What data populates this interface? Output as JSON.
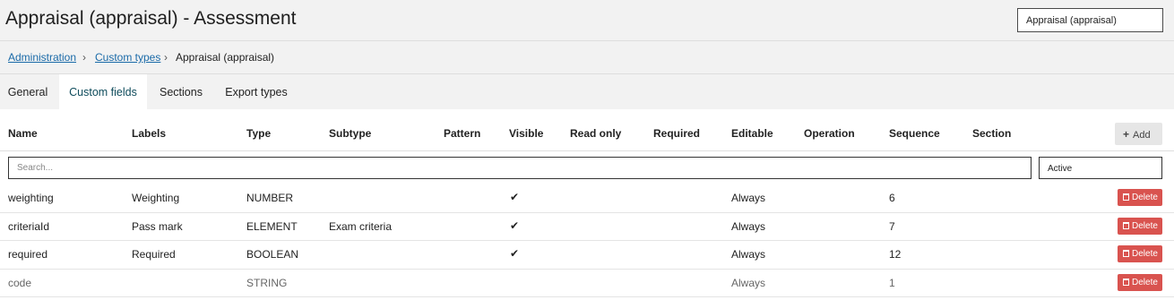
{
  "header": {
    "title": "Appraisal (appraisal) - Assessment",
    "type_select_value": "Appraisal (appraisal)"
  },
  "breadcrumb": {
    "items": [
      "Administration",
      "Custom types",
      "Appraisal (appraisal)"
    ],
    "separator": "›"
  },
  "tabs": [
    {
      "label": "General"
    },
    {
      "label": "Custom fields",
      "active": true
    },
    {
      "label": "Sections"
    },
    {
      "label": "Export types"
    }
  ],
  "table": {
    "columns": [
      "Name",
      "Labels",
      "Type",
      "Subtype",
      "Pattern",
      "Visible",
      "Read only",
      "Required",
      "Editable",
      "Operation",
      "Sequence",
      "Section"
    ],
    "add_label": "Add",
    "search_placeholder": "Search...",
    "status_filter": "Active",
    "check_icon": "check-icon",
    "delete_label": "Delete",
    "rows": [
      {
        "name": "weighting",
        "labels": "Weighting",
        "type": "NUMBER",
        "subtype": "",
        "visible": true,
        "editable": "Always",
        "sequence": "6"
      },
      {
        "name": "criteriaId",
        "labels": "Pass mark",
        "type": "ELEMENT",
        "subtype": "Exam criteria",
        "visible": true,
        "editable": "Always",
        "sequence": "7"
      },
      {
        "name": "required",
        "labels": "Required",
        "type": "BOOLEAN",
        "subtype": "",
        "visible": true,
        "editable": "Always",
        "sequence": "12"
      },
      {
        "name": "code",
        "labels": "",
        "type": "STRING",
        "subtype": "",
        "visible": false,
        "editable": "Always",
        "sequence": "1",
        "muted": true
      }
    ]
  },
  "colors": {
    "link": "#1a6aa8",
    "active_tab_text": "#0f4c5c",
    "delete_button": "#d9534f",
    "panel_background": "#f2f2f2"
  }
}
